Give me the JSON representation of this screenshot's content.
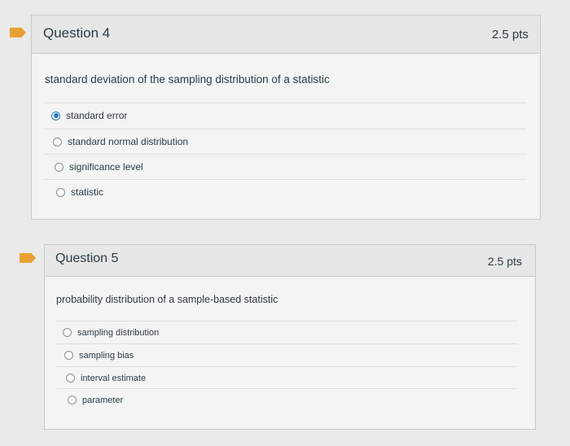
{
  "questions": [
    {
      "title": "Question 4",
      "points": "2.5 pts",
      "prompt": "standard deviation of the sampling distribution of a statistic",
      "answers": [
        {
          "label": "standard error",
          "selected": true
        },
        {
          "label": "standard normal distribution",
          "selected": false
        },
        {
          "label": "significance level",
          "selected": false
        },
        {
          "label": "statistic",
          "selected": false
        }
      ]
    },
    {
      "title": "Question 5",
      "points": "2.5 pts",
      "prompt": "probability distribution of a sample-based statistic",
      "answers": [
        {
          "label": "sampling distribution",
          "selected": false
        },
        {
          "label": "sampling bias",
          "selected": false
        },
        {
          "label": "interval estimate",
          "selected": false
        },
        {
          "label": "parameter",
          "selected": false
        }
      ]
    }
  ],
  "colors": {
    "flag": "#e8a131",
    "radio_selected": "#2b7abc",
    "text": "#2d3b45"
  }
}
